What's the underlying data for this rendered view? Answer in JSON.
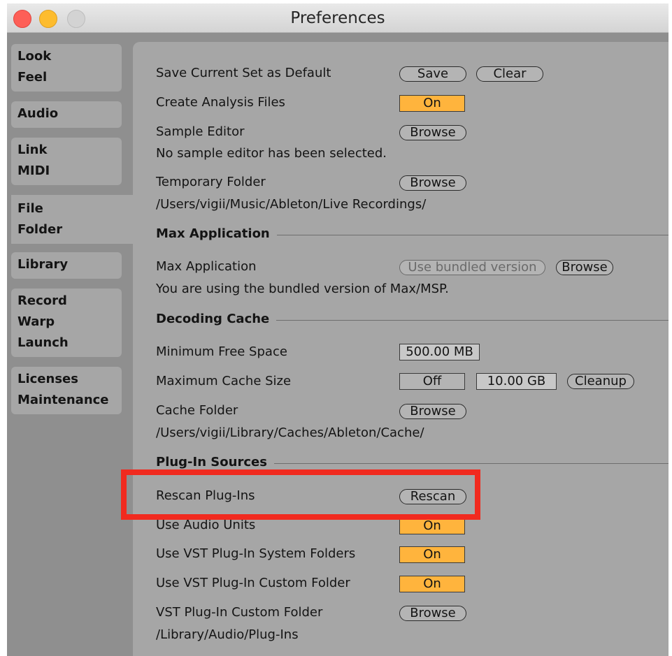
{
  "window": {
    "title": "Preferences"
  },
  "sidebar": {
    "tabs": [
      {
        "lines": [
          "Look",
          "Feel"
        ]
      },
      {
        "lines": [
          "Audio"
        ]
      },
      {
        "lines": [
          "Link",
          "MIDI"
        ]
      },
      {
        "lines": [
          "File",
          "Folder"
        ],
        "active": true
      },
      {
        "lines": [
          "Library"
        ]
      },
      {
        "lines": [
          "Record",
          "Warp",
          "Launch"
        ]
      },
      {
        "lines": [
          "Licenses",
          "Maintenance"
        ]
      }
    ]
  },
  "prefs": {
    "save_default_label": "Save Current Set as Default",
    "save_button": "Save",
    "clear_button": "Clear",
    "analysis_label": "Create Analysis Files",
    "analysis_value": "On",
    "sample_editor_label": "Sample Editor",
    "browse_label": "Browse",
    "sample_editor_status": "No sample editor has been selected.",
    "temp_folder_label": "Temporary Folder",
    "temp_folder_path": "/Users/vigii/Music/Ableton/Live Recordings/",
    "max_section": "Max Application",
    "max_label": "Max Application",
    "max_bundled_button": "Use bundled version",
    "max_status": "You are using the bundled version of Max/MSP.",
    "decoding_section": "Decoding Cache",
    "min_free_label": "Minimum Free Space",
    "min_free_value": "500.00 MB",
    "max_cache_label": "Maximum Cache Size",
    "max_cache_toggle": "Off",
    "max_cache_value": "10.00 GB",
    "cleanup_button": "Cleanup",
    "cache_folder_label": "Cache Folder",
    "cache_folder_path": "/Users/vigii/Library/Caches/Ableton/Cache/",
    "plugin_section": "Plug-In Sources",
    "rescan_label": "Rescan Plug-Ins",
    "rescan_button": "Rescan",
    "audio_units_label": "Use Audio Units",
    "audio_units_value": "On",
    "vst_system_label": "Use VST Plug-In System Folders",
    "vst_system_value": "On",
    "vst_custom_label": "Use VST Plug-In Custom Folder",
    "vst_custom_value": "On",
    "vst_folder_label": "VST Plug-In Custom Folder",
    "vst_folder_path": "/Library/Audio/Plug-Ins"
  },
  "colors": {
    "toggle_on": "#ffb43d",
    "highlight": "#f12a1f",
    "panel": "#a6a6a6",
    "sidebar": "#8f8f8f"
  }
}
